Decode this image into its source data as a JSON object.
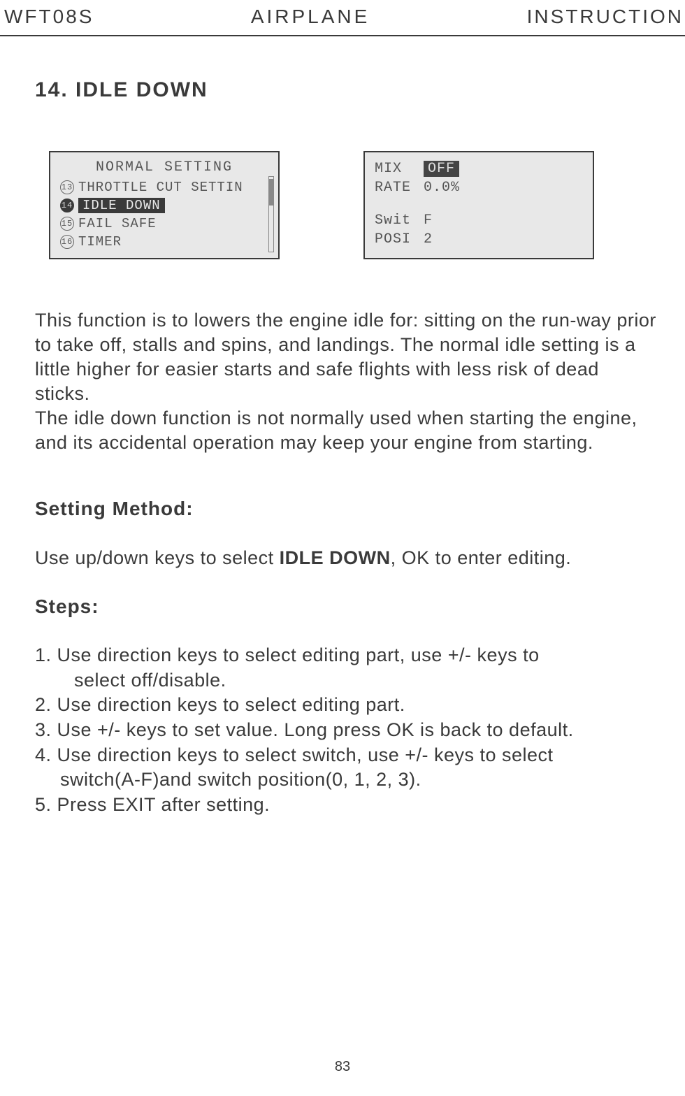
{
  "header": {
    "left": "WFT08S",
    "center": "AIRPLANE",
    "right": "INSTRUCTION"
  },
  "section_title": "14. IDLE DOWN",
  "screen1": {
    "title": "NORMAL SETTING",
    "items": [
      {
        "num": "13",
        "label": "THROTTLE CUT SETTIN",
        "selected": false
      },
      {
        "num": "14",
        "label": "IDLE DOWN",
        "selected": true
      },
      {
        "num": "15",
        "label": "FAIL SAFE",
        "selected": false
      },
      {
        "num": "16",
        "label": "TIMER",
        "selected": false
      }
    ]
  },
  "screen2": {
    "mix_label": "MIX",
    "mix_value": "OFF",
    "rate_label": "RATE",
    "rate_value": "0.0%",
    "swit_label": "Swit",
    "swit_value": "F",
    "posi_label": "POSI",
    "posi_value": "2"
  },
  "description_p1": "This function is to lowers the engine idle for: sitting on the run-way prior to take off, stalls and spins, and landings. The normal idle setting is a little higher for easier starts and safe flights with less risk of dead sticks.",
  "description_p2": "The idle down function is not normally used when starting the engine, and its accidental operation may keep your engine from starting.",
  "setting_method_heading": "Setting Method:",
  "setting_method_text_pre": "Use up/down keys to select ",
  "setting_method_text_bold": "IDLE DOWN",
  "setting_method_text_post": ", OK to enter editing.",
  "steps_heading": "Steps:",
  "steps": [
    "1. Use direction keys to select  editing part, use +/- keys to",
    "select off/disable.",
    "2. Use  direction  keys  to  select  editing  part.",
    "3. Use +/- keys to set value. Long  press OK is back to default.",
    "4. Use  direction keys to select switch,   use  +/-  keys  to  select",
    "switch(A-F)and  switch  position(0, 1, 2, 3).",
    "5. Press EXIT after setting."
  ],
  "page_number": "83"
}
